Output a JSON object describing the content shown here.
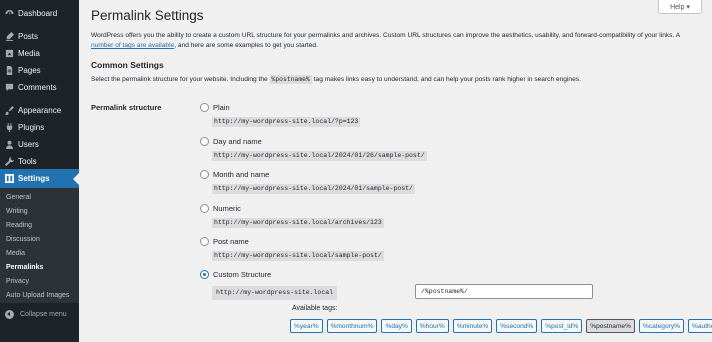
{
  "sidebar": {
    "items": [
      {
        "label": "Dashboard",
        "icon": "dashboard-icon"
      },
      {
        "label": "Posts",
        "icon": "posts-icon"
      },
      {
        "label": "Media",
        "icon": "media-icon"
      },
      {
        "label": "Pages",
        "icon": "pages-icon"
      },
      {
        "label": "Comments",
        "icon": "comments-icon"
      },
      {
        "label": "Appearance",
        "icon": "appearance-icon"
      },
      {
        "label": "Plugins",
        "icon": "plugins-icon"
      },
      {
        "label": "Users",
        "icon": "users-icon"
      },
      {
        "label": "Tools",
        "icon": "tools-icon"
      },
      {
        "label": "Settings",
        "icon": "settings-icon"
      }
    ],
    "submenu": [
      "General",
      "Writing",
      "Reading",
      "Discussion",
      "Media",
      "Permalinks",
      "Privacy",
      "Auto Upload Images"
    ],
    "current_submenu": "Permalinks",
    "collapse_label": "Collapse menu"
  },
  "header": {
    "help_label": "Help ▾"
  },
  "page": {
    "title": "Permalink Settings",
    "intro_1": "WordPress offers you the ability to create a custom URL structure for your permalinks and archives. Custom URL structures can improve the aesthetics, usability, and forward-compatibility of your links. A ",
    "intro_link": "number of tags are available",
    "intro_2": ", and here are some examples to get you started.",
    "common_heading": "Common Settings",
    "desc_1": "Select the permalink structure for your website. Including the ",
    "desc_code": "%postname%",
    "desc_2": " tag makes links easy to understand, and can help your posts rank higher in search engines.",
    "structure_label": "Permalink structure"
  },
  "options": [
    {
      "label": "Plain",
      "example": "http://my-wordpress-site.local/?p=123",
      "selected": false
    },
    {
      "label": "Day and name",
      "example": "http://my-wordpress-site.local/2024/01/26/sample-post/",
      "selected": false
    },
    {
      "label": "Month and name",
      "example": "http://my-wordpress-site.local/2024/01/sample-post/",
      "selected": false
    },
    {
      "label": "Numeric",
      "example": "http://my-wordpress-site.local/archives/123",
      "selected": false
    },
    {
      "label": "Post name",
      "example": "http://my-wordpress-site.local/sample-post/",
      "selected": false
    },
    {
      "label": "Custom Structure",
      "example": "http://my-wordpress-site.local",
      "selected": true
    }
  ],
  "custom": {
    "value": "/%postname%/",
    "available_label": "Available tags:"
  },
  "tags": [
    "%year%",
    "%monthnum%",
    "%day%",
    "%hour%",
    "%minute%",
    "%second%",
    "%post_id%",
    "%postname%",
    "%category%",
    "%author%"
  ],
  "active_tag": "%postname%",
  "colors": {
    "sidebar_bg": "#1d2327",
    "accent": "#2271b1",
    "submenu_bg": "#2c3338",
    "page_bg": "#f0f0f1"
  }
}
